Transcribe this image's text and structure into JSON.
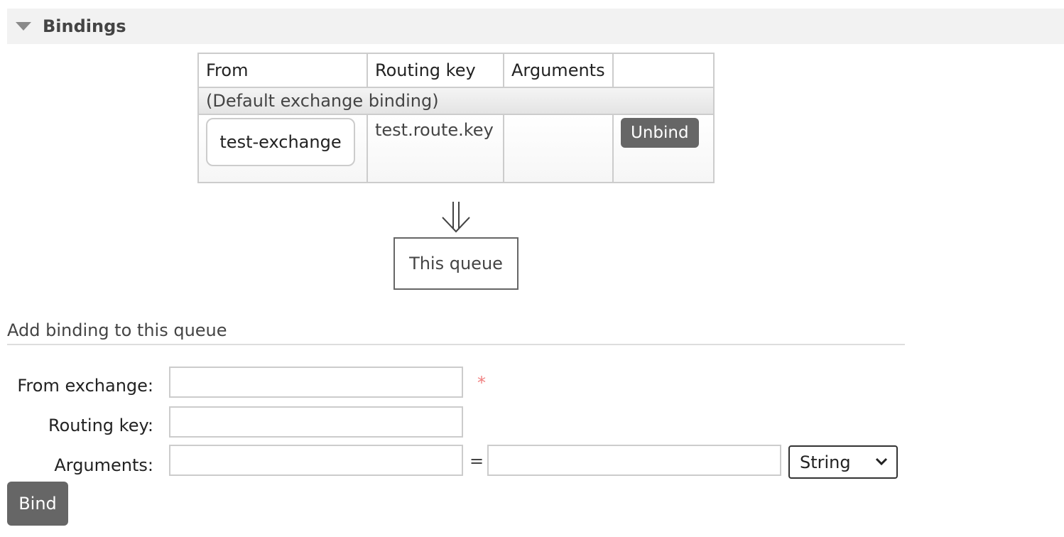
{
  "section": {
    "title": "Bindings",
    "collapse_icon": "triangle-down-icon"
  },
  "table": {
    "headers": [
      "From",
      "Routing key",
      "Arguments",
      ""
    ],
    "default_row": "(Default exchange binding)",
    "rows": [
      {
        "from": "test-exchange",
        "routing_key": "test.route.key",
        "arguments": "",
        "action": "Unbind"
      }
    ]
  },
  "flow": {
    "arrow_icon": "double-down-arrow-icon",
    "queue_label": "This queue"
  },
  "form": {
    "title": "Add binding to this queue",
    "from_exchange_label": "From exchange:",
    "from_exchange_value": "",
    "required_mark": "*",
    "routing_key_label": "Routing key:",
    "routing_key_value": "",
    "arguments_label": "Arguments:",
    "argument_key_value": "",
    "equals": "=",
    "argument_value": "",
    "type_selected": "String",
    "submit_label": "Bind"
  },
  "colors": {
    "button_bg": "#666666",
    "required": "#f08080",
    "header_bg": "#f2f2f2"
  }
}
